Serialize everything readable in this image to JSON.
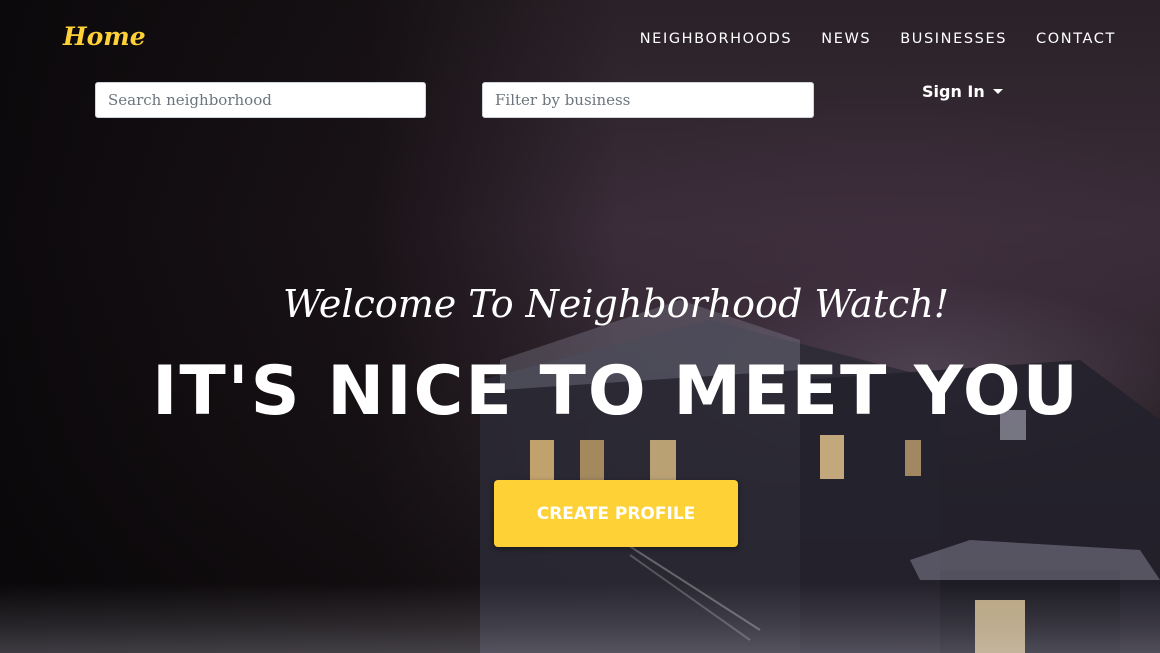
{
  "brand": "Home",
  "nav": {
    "items": [
      "NEIGHBORHOODS",
      "NEWS",
      "BUSINESSES",
      "CONTACT"
    ]
  },
  "search": {
    "neighborhood_placeholder": "Search neighborhood",
    "business_placeholder": "Filter by business"
  },
  "account": {
    "sign_in_label": "Sign In"
  },
  "hero": {
    "lead": "Welcome To Neighborhood Watch!",
    "heading": "IT'S NICE TO MEET YOU",
    "cta_label": "CREATE PROFILE"
  },
  "colors": {
    "accent": "#fed136",
    "text": "#ffffff"
  }
}
